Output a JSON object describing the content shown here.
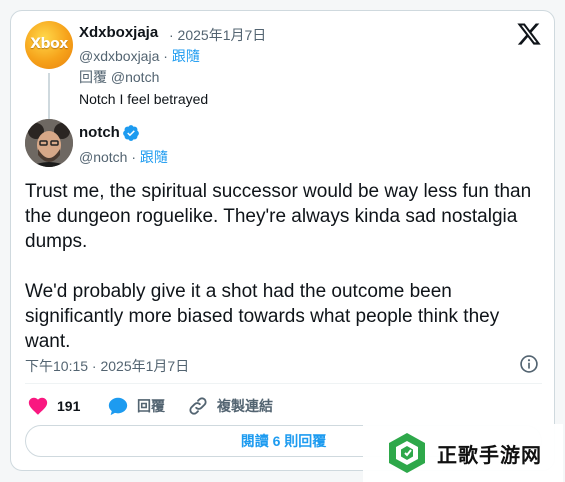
{
  "parent_tweet": {
    "avatar_text": "Xbox",
    "display_name": "Xdxboxjaja",
    "date": "· 2025年1月7日",
    "handle": "@xdxboxjaja",
    "separator": "·",
    "follow_label": "跟隨",
    "reply_prefix": "回覆",
    "reply_to": "@notch",
    "text": "Notch I feel betrayed"
  },
  "main_tweet": {
    "display_name": "notch",
    "verified": true,
    "handle": "@notch",
    "separator": "·",
    "follow_label": "跟隨",
    "paragraphs": [
      "Trust me, the spiritual successor would be way less fun than the dungeon roguelike. They're always kinda sad nostalgia dumps.",
      "We'd probably give it a shot had the outcome been significantly more biased towards what people think they want."
    ],
    "timestamp": "下午10:15 · 2025年1月7日"
  },
  "actions": {
    "like_count": "191",
    "reply_label": "回覆",
    "copy_link_label": "複製連結"
  },
  "read_replies_label": "閱讀 6 則回覆",
  "watermark": {
    "text": "正歌手游网"
  },
  "icons": {
    "x_logo": "x-logo-icon",
    "verified": "verified-badge-icon",
    "info": "info-icon",
    "like": "heart-icon",
    "reply": "speech-bubble-icon",
    "copy_link": "link-icon"
  },
  "colors": {
    "accent": "#1d9bf0",
    "like": "#f91880",
    "text": "#0f1419",
    "muted": "#536471",
    "border": "#cfd9de"
  }
}
